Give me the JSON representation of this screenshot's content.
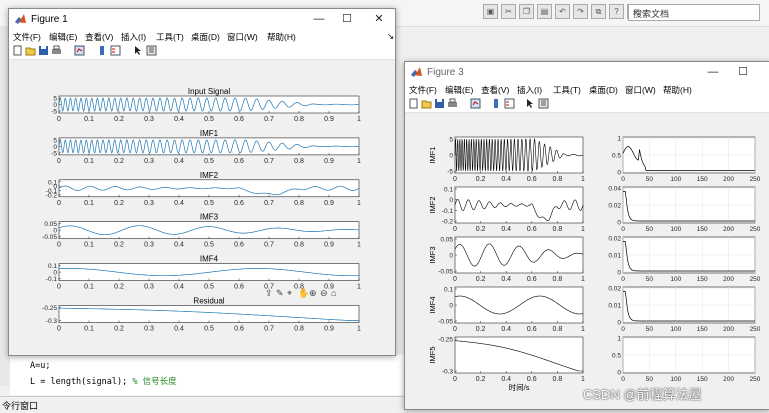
{
  "desktop": {
    "search_placeholder": "搜索文档",
    "code_lines": [
      "A=u;",
      "L = length(signal);",
      "% 信号长度"
    ],
    "status_text": "令行窗口",
    "watermark": "CSDN @前程算法屋"
  },
  "figure1": {
    "title": "Figure 1",
    "menus": [
      "文件(F)",
      "编辑(E)",
      "查看(V)",
      "插入(I)",
      "工具(T)",
      "桌面(D)",
      "窗口(W)",
      "帮助(H)"
    ],
    "panels": [
      {
        "title": "Input Signal",
        "yticks": [
          "5",
          "0",
          "-5"
        ]
      },
      {
        "title": "IMF1",
        "yticks": [
          "5",
          "0",
          "-5"
        ]
      },
      {
        "title": "IMF2",
        "yticks": [
          "0.1",
          "0",
          "-0.1",
          "-0.2"
        ]
      },
      {
        "title": "IMF3",
        "yticks": [
          "0.05",
          "0",
          "-0.05"
        ]
      },
      {
        "title": "IMF4",
        "yticks": [
          "0.1",
          "0",
          "-0.1"
        ]
      },
      {
        "title": "Residual",
        "yticks": [
          "-0.25",
          "-0.3"
        ]
      }
    ],
    "xticks": [
      "0",
      "0.1",
      "0.2",
      "0.3",
      "0.4",
      "0.5",
      "0.6",
      "0.7",
      "0.8",
      "0.9",
      "1"
    ]
  },
  "figure3": {
    "title": "Figure 3",
    "menus": [
      "文件(F)",
      "编辑(E)",
      "查看(V)",
      "插入(I)",
      "工具(T)",
      "桌面(D)",
      "窗口(W)",
      "帮助(H)"
    ],
    "left_panels": [
      {
        "ylabel": "IMF1",
        "yticks": [
          "5",
          "0",
          "-5"
        ]
      },
      {
        "ylabel": "IMF2",
        "yticks": [
          "0.1",
          "0",
          "-0.1",
          "-0.2"
        ]
      },
      {
        "ylabel": "IMF3",
        "yticks": [
          "0.05",
          "0",
          "-0.05"
        ]
      },
      {
        "ylabel": "IMF4",
        "yticks": [
          "0.1",
          "0",
          "-0.05"
        ]
      },
      {
        "ylabel": "IMF5",
        "yticks": [
          "-0.25",
          "-0.3"
        ]
      }
    ],
    "left_xticks_top": [
      "0",
      "0.2",
      "0.4",
      "0.6",
      "0.8",
      "1"
    ],
    "left_xticks_bottom": [
      "0",
      "0.2",
      "0.4",
      "0.6",
      "0.8",
      "1"
    ],
    "left_xlabel": "时间/s",
    "right_panels": [
      {
        "yticks": [
          "1",
          "0.5",
          "0"
        ]
      },
      {
        "yticks": [
          "0.04",
          "0.02",
          "0"
        ]
      },
      {
        "yticks": [
          "0.02",
          "0.01",
          "0"
        ]
      },
      {
        "yticks": [
          "0.02",
          "0.01",
          "0"
        ]
      },
      {
        "yticks": [
          "1",
          "0.5",
          "0"
        ]
      }
    ],
    "right_xticks": [
      "0",
      "50",
      "100",
      "150",
      "200",
      "250"
    ]
  }
}
